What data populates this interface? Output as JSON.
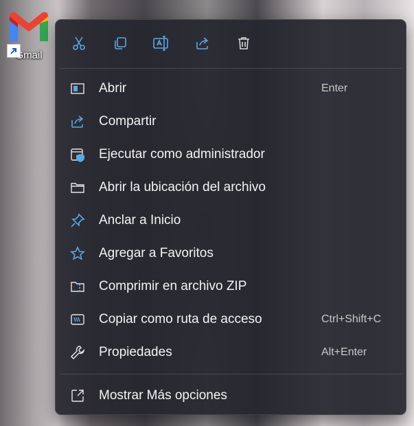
{
  "desktop": {
    "icon_label": "Gmail"
  },
  "toolbar": [
    {
      "name": "cut-icon",
      "label": "Cortar"
    },
    {
      "name": "copy-icon",
      "label": "Copiar"
    },
    {
      "name": "rename-icon",
      "label": "Cambiar nombre"
    },
    {
      "name": "share-icon",
      "label": "Compartir"
    },
    {
      "name": "delete-icon",
      "label": "Eliminar"
    }
  ],
  "menu": {
    "items": [
      {
        "label": "Abrir",
        "accel": "Enter",
        "icon": "open-icon"
      },
      {
        "label": "Compartir",
        "accel": "",
        "icon": "share-icon"
      },
      {
        "label": "Ejecutar como administrador",
        "accel": "",
        "icon": "run-as-admin-icon"
      },
      {
        "label": "Abrir la ubicación del archivo",
        "accel": "",
        "icon": "folder-icon"
      },
      {
        "label": "Anclar a Inicio",
        "accel": "",
        "icon": "pin-icon"
      },
      {
        "label": "Agregar a Favoritos",
        "accel": "",
        "icon": "star-icon"
      },
      {
        "label": "Comprimir en archivo ZIP",
        "accel": "",
        "icon": "zip-icon"
      },
      {
        "label": "Copiar como ruta de acceso",
        "accel": "Ctrl+Shift+C",
        "icon": "copy-path-icon"
      },
      {
        "label": "Propiedades",
        "accel": "Alt+Enter",
        "icon": "wrench-icon"
      }
    ],
    "more": {
      "label": "Mostrar Más opciones",
      "icon": "show-more-icon"
    }
  },
  "colors": {
    "accent": "#5aa9e6",
    "menu_bg": "#26262e",
    "text": "#f4f4f4",
    "accel": "#c9c9c9"
  }
}
